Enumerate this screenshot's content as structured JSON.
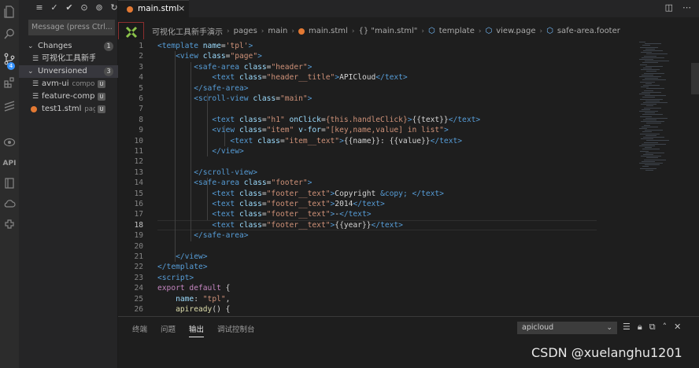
{
  "activity_bar": {
    "items": [
      "files-icon",
      "search-icon",
      "source-control-icon",
      "extensions-icon",
      "layers-icon",
      "preview-icon",
      "api-icon",
      "book-icon",
      "cloud-icon",
      "plugin-icon"
    ],
    "source_control_badge": "4",
    "api_label": "API"
  },
  "sidebar": {
    "toolbar": [
      "list-icon",
      "check-icon",
      "check-all-icon",
      "update-icon",
      "commit-icon",
      "refresh-icon"
    ],
    "message_placeholder": "Message (press Ctrl...",
    "changes": {
      "label": "Changes",
      "count": "1"
    },
    "changes_files": [
      {
        "name": "可视化工具新手演...",
        "desc": "",
        "status": ""
      }
    ],
    "unversioned": {
      "label": "Unversioned",
      "count": "3"
    },
    "unversioned_files": [
      {
        "name": "avm-ui",
        "desc": "compo...",
        "status": "U",
        "icon": "file"
      },
      {
        "name": "feature-comp...",
        "desc": "",
        "status": "U",
        "icon": "file"
      },
      {
        "name": "test1.stml",
        "desc": "pag...",
        "status": "U",
        "icon": "stml"
      }
    ]
  },
  "tabs": [
    {
      "label": "main.stml",
      "close": "×"
    }
  ],
  "tab_actions": [
    "split-editor-icon",
    "more-icon"
  ],
  "breadcrumb": [
    "可视化工具新手演示",
    "pages",
    "main",
    "main.stml",
    "{} \"main.stml\"",
    "template",
    "view.page",
    "safe-area.footer"
  ],
  "editor": {
    "current_line": 18,
    "line_numbers": [
      "1",
      "2",
      "3",
      "4",
      "5",
      "6",
      "7",
      "8",
      "9",
      "10",
      "11",
      "12",
      "13",
      "14",
      "15",
      "16",
      "17",
      "18",
      "19",
      "20",
      "21",
      "22",
      "23",
      "24",
      "25",
      "26"
    ],
    "lines": [
      [
        [
          "t-tag",
          "<template "
        ],
        [
          "t-attr",
          "name"
        ],
        [
          "t-txt",
          "="
        ],
        [
          "t-str",
          "'tpl'"
        ],
        [
          "t-tag",
          ">"
        ]
      ],
      [
        [
          "t-txt",
          "    "
        ],
        [
          "t-tag",
          "<view "
        ],
        [
          "t-attr",
          "class"
        ],
        [
          "t-txt",
          "="
        ],
        [
          "t-str",
          "\"page\""
        ],
        [
          "t-tag",
          ">"
        ]
      ],
      [
        [
          "t-txt",
          "        "
        ],
        [
          "t-tag",
          "<safe-area "
        ],
        [
          "t-attr",
          "class"
        ],
        [
          "t-txt",
          "="
        ],
        [
          "t-str",
          "\"header\""
        ],
        [
          "t-tag",
          ">"
        ]
      ],
      [
        [
          "t-txt",
          "            "
        ],
        [
          "t-tag",
          "<text "
        ],
        [
          "t-attr",
          "class"
        ],
        [
          "t-txt",
          "="
        ],
        [
          "t-str",
          "\"header__title\""
        ],
        [
          "t-tag",
          ">"
        ],
        [
          "t-txt",
          "APICloud"
        ],
        [
          "t-tag",
          "</text>"
        ]
      ],
      [
        [
          "t-txt",
          "        "
        ],
        [
          "t-tag",
          "</safe-area>"
        ]
      ],
      [
        [
          "t-txt",
          "        "
        ],
        [
          "t-tag",
          "<scroll-view "
        ],
        [
          "t-attr",
          "class"
        ],
        [
          "t-txt",
          "="
        ],
        [
          "t-str",
          "\"main\""
        ],
        [
          "t-tag",
          ">"
        ]
      ],
      [
        [
          "t-txt",
          ""
        ]
      ],
      [
        [
          "t-txt",
          "            "
        ],
        [
          "t-tag",
          "<text "
        ],
        [
          "t-attr",
          "class"
        ],
        [
          "t-txt",
          "="
        ],
        [
          "t-str",
          "\"h1\" "
        ],
        [
          "t-attr",
          "onClick"
        ],
        [
          "t-txt",
          "="
        ],
        [
          "t-str",
          "{this.handleClick}"
        ],
        [
          "t-tag",
          ">"
        ],
        [
          "t-txt",
          "{{text}}"
        ],
        [
          "t-tag",
          "</text>"
        ]
      ],
      [
        [
          "t-txt",
          "            "
        ],
        [
          "t-tag",
          "<view "
        ],
        [
          "t-attr",
          "class"
        ],
        [
          "t-txt",
          "="
        ],
        [
          "t-str",
          "\"item\" "
        ],
        [
          "t-attr",
          "v-for"
        ],
        [
          "t-txt",
          "="
        ],
        [
          "t-str",
          "\"[key,name,value] in list\""
        ],
        [
          "t-tag",
          ">"
        ]
      ],
      [
        [
          "t-txt",
          "                "
        ],
        [
          "t-tag",
          "<text "
        ],
        [
          "t-attr",
          "class"
        ],
        [
          "t-txt",
          "="
        ],
        [
          "t-str",
          "\"item__text\""
        ],
        [
          "t-tag",
          ">"
        ],
        [
          "t-txt",
          "{{name}}: {{value}}"
        ],
        [
          "t-tag",
          "</text>"
        ]
      ],
      [
        [
          "t-txt",
          "            "
        ],
        [
          "t-tag",
          "</view>"
        ]
      ],
      [
        [
          "t-txt",
          ""
        ]
      ],
      [
        [
          "t-txt",
          "        "
        ],
        [
          "t-tag",
          "</scroll-view>"
        ]
      ],
      [
        [
          "t-txt",
          "        "
        ],
        [
          "t-tag",
          "<safe-area "
        ],
        [
          "t-attr",
          "class"
        ],
        [
          "t-txt",
          "="
        ],
        [
          "t-str",
          "\"footer\""
        ],
        [
          "t-tag",
          ">"
        ]
      ],
      [
        [
          "t-txt",
          "            "
        ],
        [
          "t-tag",
          "<text "
        ],
        [
          "t-attr",
          "class"
        ],
        [
          "t-txt",
          "="
        ],
        [
          "t-str",
          "\"footer__text\""
        ],
        [
          "t-tag",
          ">"
        ],
        [
          "t-txt",
          "Copyright "
        ],
        [
          "t-bl",
          "&copy;"
        ],
        [
          "t-txt",
          " "
        ],
        [
          "t-tag",
          "</text>"
        ]
      ],
      [
        [
          "t-txt",
          "            "
        ],
        [
          "t-tag",
          "<text "
        ],
        [
          "t-attr",
          "class"
        ],
        [
          "t-txt",
          "="
        ],
        [
          "t-str",
          "\"footer__text\""
        ],
        [
          "t-tag",
          ">"
        ],
        [
          "t-txt",
          "2014"
        ],
        [
          "t-tag",
          "</text>"
        ]
      ],
      [
        [
          "t-txt",
          "            "
        ],
        [
          "t-tag",
          "<text "
        ],
        [
          "t-attr",
          "class"
        ],
        [
          "t-txt",
          "="
        ],
        [
          "t-str",
          "\"footer__text\""
        ],
        [
          "t-tag",
          ">"
        ],
        [
          "t-txt",
          "-"
        ],
        [
          "t-tag",
          "</text>"
        ]
      ],
      [
        [
          "t-txt",
          "            "
        ],
        [
          "t-tag",
          "<text "
        ],
        [
          "t-attr",
          "class"
        ],
        [
          "t-txt",
          "="
        ],
        [
          "t-str",
          "\"footer__text\""
        ],
        [
          "t-tag",
          ">"
        ],
        [
          "t-txt",
          "{{year}}"
        ],
        [
          "t-tag",
          "</text>"
        ]
      ],
      [
        [
          "t-txt",
          "        "
        ],
        [
          "t-tag",
          "</safe-area>"
        ]
      ],
      [
        [
          "t-txt",
          ""
        ]
      ],
      [
        [
          "t-txt",
          "    "
        ],
        [
          "t-tag",
          "</view>"
        ]
      ],
      [
        [
          "t-tag",
          "</template>"
        ]
      ],
      [
        [
          "t-tag",
          "<script>"
        ]
      ],
      [
        [
          "t-kw",
          "export default "
        ],
        [
          "t-txt",
          "{"
        ]
      ],
      [
        [
          "t-txt",
          "    "
        ],
        [
          "t-attr",
          "name"
        ],
        [
          "t-txt",
          ": "
        ],
        [
          "t-str",
          "\"tpl\""
        ],
        [
          "t-txt",
          ","
        ]
      ],
      [
        [
          "t-txt",
          "    "
        ],
        [
          "t-fn",
          "apiready"
        ],
        [
          "t-txt",
          "() {"
        ]
      ]
    ]
  },
  "panel": {
    "tabs": [
      {
        "label": "终端",
        "active": false
      },
      {
        "label": "问题",
        "active": false
      },
      {
        "label": "输出",
        "active": true
      },
      {
        "label": "调试控制台",
        "active": false
      }
    ],
    "output_select": "apicloud",
    "actions": [
      "clear-output-icon",
      "lock-icon",
      "copy-icon",
      "maximize-icon",
      "close-icon"
    ]
  },
  "watermark": "CSDN @xuelanghu1201"
}
